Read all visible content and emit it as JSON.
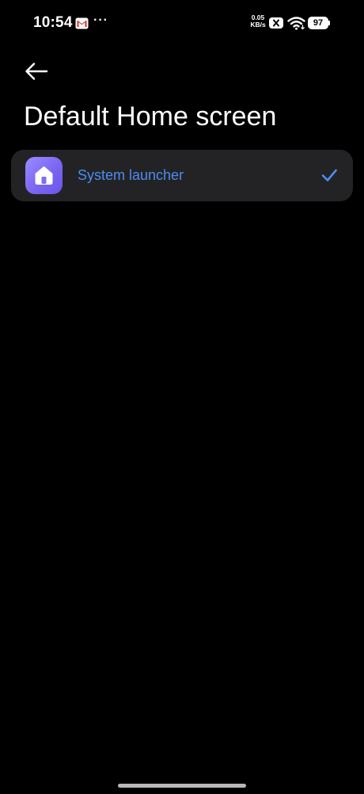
{
  "status_bar": {
    "time": "10:54",
    "notification_icons": [
      "gmail-icon",
      "more-icon"
    ],
    "more_indicator": "···",
    "net_speed_value": "0.05",
    "net_speed_unit": "KB/s",
    "wifi_icon": "wifi-icon",
    "battery_level": "97"
  },
  "header": {
    "back_icon": "arrow-left-icon",
    "title": "Default Home screen"
  },
  "options": [
    {
      "label": "System launcher",
      "icon": "home-icon",
      "selected": true,
      "selected_icon": "check-icon"
    }
  ],
  "colors": {
    "background": "#000000",
    "card": "#232325",
    "accent": "#4d8cf0",
    "app_icon_gradient_start": "#9a8cff",
    "app_icon_gradient_end": "#6a55e8"
  }
}
